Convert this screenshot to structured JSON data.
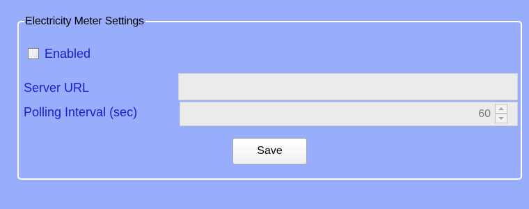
{
  "settings": {
    "group_title": "Electricity Meter Settings",
    "enabled": {
      "label": "Enabled",
      "checked": false
    },
    "server_url": {
      "label": "Server URL",
      "value": "",
      "placeholder": ""
    },
    "polling_interval": {
      "label": "Polling Interval (sec)",
      "value": "60"
    },
    "save_label": "Save"
  },
  "colors": {
    "background": "#98aefc",
    "label_text": "#1b1bd0",
    "group_border": "#ffffff",
    "disabled_field": "#ebebeb"
  },
  "icons": {
    "checkbox": "checkbox-unchecked-icon",
    "spin_up": "spin-up-arrow-icon",
    "spin_down": "spin-down-arrow-icon"
  }
}
